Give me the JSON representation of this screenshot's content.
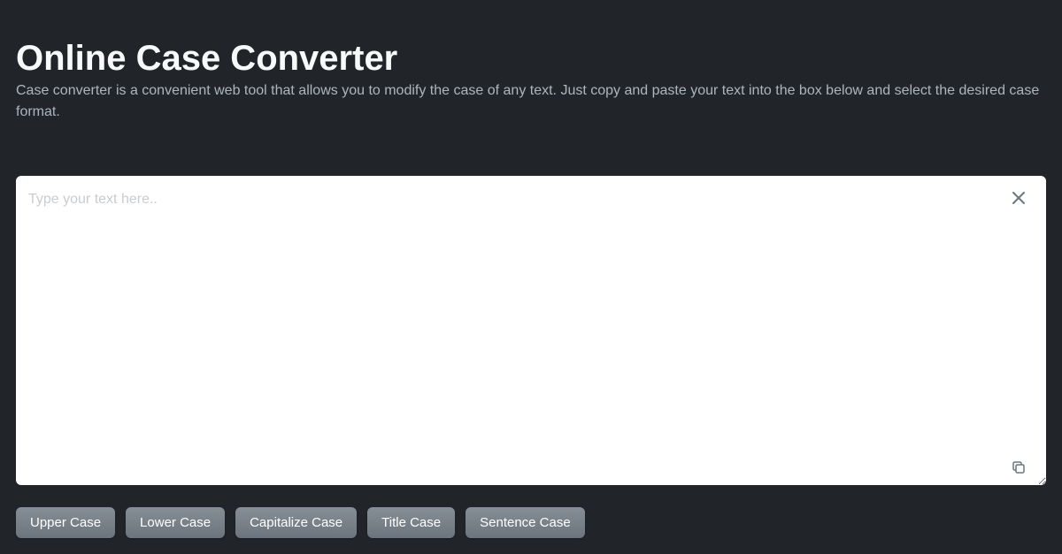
{
  "header": {
    "title": "Online Case Converter",
    "description": "Case converter is a convenient web tool that allows you to modify the case of any text. Just copy and paste your text into the box below and select the desired case format."
  },
  "textarea": {
    "placeholder": "Type your text here..",
    "value": ""
  },
  "buttons": {
    "upper": "Upper Case",
    "lower": "Lower Case",
    "capitalize": "Capitalize Case",
    "title": "Title Case",
    "sentence": "Sentence Case"
  }
}
